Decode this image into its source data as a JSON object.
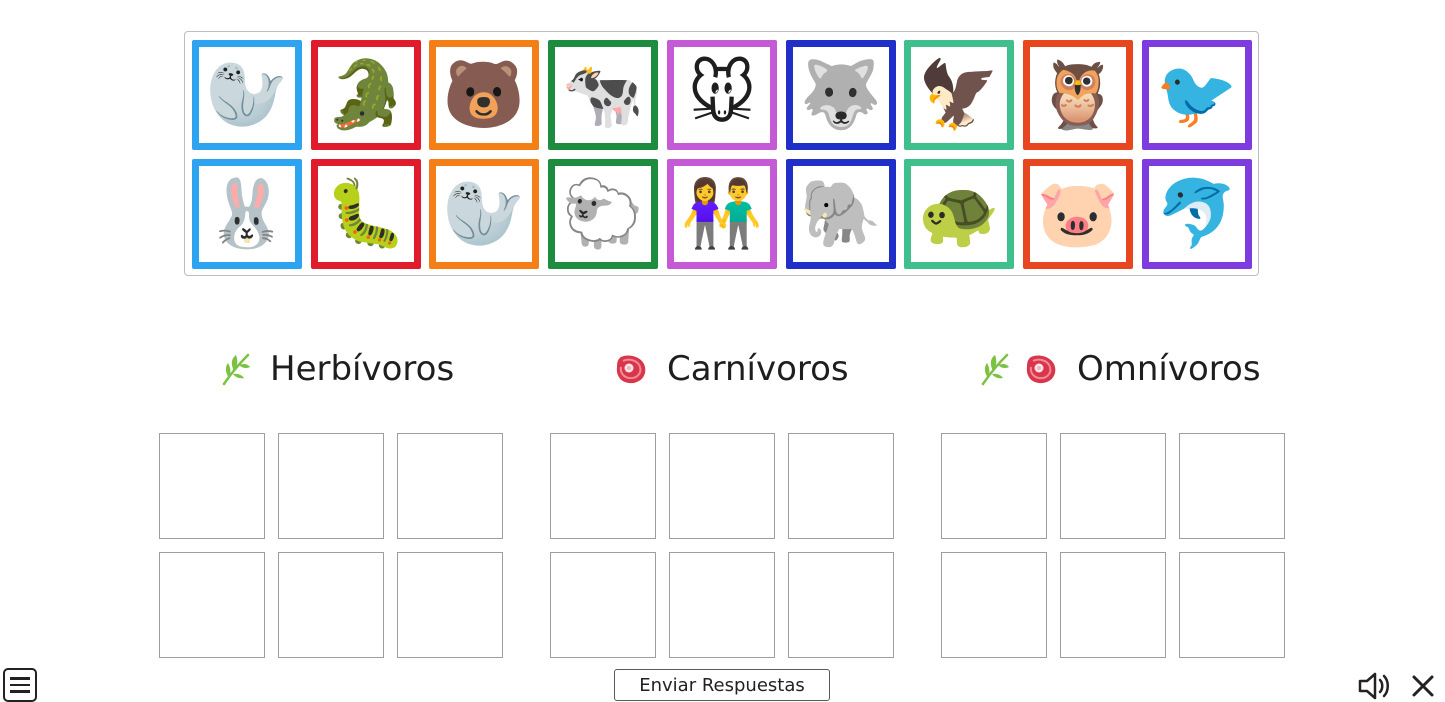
{
  "bank": {
    "tiles": [
      {
        "name": "seal",
        "icon": "🦭",
        "color": "#2ea3ef"
      },
      {
        "name": "crocodile",
        "icon": "🐊",
        "color": "#e01b2c"
      },
      {
        "name": "bear",
        "icon": "🐻",
        "color": "#f57f17"
      },
      {
        "name": "cow",
        "icon": "🐄",
        "color": "#1e8c3f"
      },
      {
        "name": "mouse",
        "icon": "🐭",
        "color": "#c45ad6"
      },
      {
        "name": "wolf",
        "icon": "🐺",
        "color": "#1f2fc8"
      },
      {
        "name": "eagle",
        "icon": "🦅",
        "color": "#3fbf8c"
      },
      {
        "name": "owl",
        "icon": "🦉",
        "color": "#e8461e"
      },
      {
        "name": "crow",
        "icon": "🐦",
        "color": "#7e3bdd"
      },
      {
        "name": "rabbit",
        "icon": "🐰",
        "color": "#2ea3ef"
      },
      {
        "name": "caterpillar",
        "icon": "🐛",
        "color": "#e01b2c"
      },
      {
        "name": "manatee",
        "icon": "🦭",
        "color": "#f57f17"
      },
      {
        "name": "sheep",
        "icon": "🐑",
        "color": "#1e8c3f"
      },
      {
        "name": "children",
        "icon": "👫",
        "color": "#c45ad6"
      },
      {
        "name": "elephant",
        "icon": "🐘",
        "color": "#1f2fc8"
      },
      {
        "name": "turtle",
        "icon": "🐢",
        "color": "#3fbf8c"
      },
      {
        "name": "pig",
        "icon": "🐷",
        "color": "#e8461e"
      },
      {
        "name": "orca",
        "icon": "🐬",
        "color": "#7e3bdd"
      }
    ]
  },
  "categories": {
    "herbivores": {
      "label": "Herbívoros",
      "icons": [
        "leaf-icon"
      ]
    },
    "carnivores": {
      "label": "Carnívoros",
      "icons": [
        "meat-icon"
      ]
    },
    "omnivores": {
      "label": "Omnívoros",
      "icons": [
        "leaf-icon",
        "meat-icon"
      ]
    }
  },
  "footer": {
    "submit_label": "Enviar Respuestas",
    "icons": [
      "menu-icon",
      "speaker-icon",
      "close-icon"
    ]
  },
  "colors": {
    "leaf": "#7cc242",
    "meat": "#d9364b",
    "slot_border": "#9e9e9e"
  }
}
